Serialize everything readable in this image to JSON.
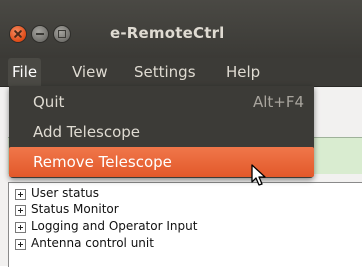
{
  "window": {
    "title": "e-RemoteCtrl"
  },
  "menubar": {
    "items": [
      {
        "label": "File"
      },
      {
        "label": "View"
      },
      {
        "label": "Settings"
      },
      {
        "label": "Help"
      }
    ]
  },
  "file_menu": {
    "items": [
      {
        "label": "Quit",
        "accelerator": "Alt+F4"
      },
      {
        "label": "Add Telescope",
        "accelerator": ""
      },
      {
        "label": "Remove Telescope",
        "accelerator": ""
      }
    ]
  },
  "tree": {
    "items": [
      {
        "label": "User status"
      },
      {
        "label": "Status Monitor"
      },
      {
        "label": "Logging and Operator Input"
      },
      {
        "label": "Antenna control unit"
      }
    ]
  },
  "colors": {
    "titlebar": "#3b3a36",
    "menu_bg": "#3c3b37",
    "highlight": "#e95420",
    "panel_green": "#d9ecd0"
  }
}
